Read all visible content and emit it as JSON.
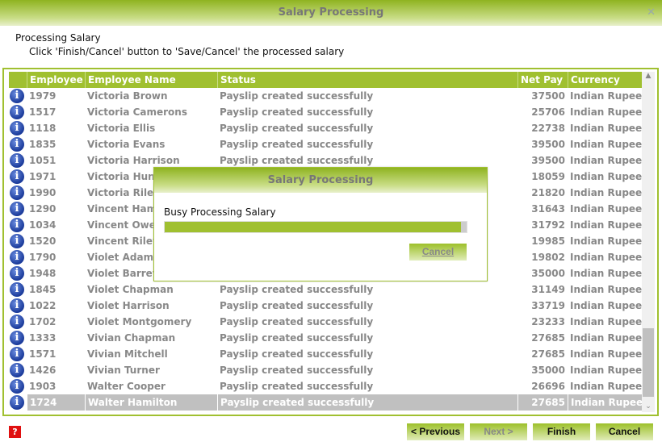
{
  "window": {
    "title": "Salary Processing",
    "close": "✕"
  },
  "heading": "Processing Salary",
  "instruction": "Click 'Finish/Cancel' button to 'Save/Cancel' the processed salary",
  "table": {
    "columns": [
      "Employee Id",
      "Employee Name",
      "Status",
      "Net Pay",
      "Currency"
    ],
    "rows": [
      [
        "1979",
        "Victoria Brown",
        "Payslip created successfully",
        "37500",
        "Indian Rupees"
      ],
      [
        "1517",
        "Victoria Camerons",
        "Payslip created successfully",
        "25706",
        "Indian Rupees"
      ],
      [
        "1118",
        "Victoria Ellis",
        "Payslip created successfully",
        "22738",
        "Indian Rupees"
      ],
      [
        "1835",
        "Victoria Evans",
        "Payslip created successfully",
        "39500",
        "Indian Rupees"
      ],
      [
        "1051",
        "Victoria Harrison",
        "Payslip created successfully",
        "39500",
        "Indian Rupees"
      ],
      [
        "1971",
        "Victoria Hunt",
        "",
        "18059",
        "Indian Rupees"
      ],
      [
        "1990",
        "Victoria Riley",
        "",
        "21820",
        "Indian Rupees"
      ],
      [
        "1290",
        "Vincent Hamil",
        "",
        "31643",
        "Indian Rupees"
      ],
      [
        "1034",
        "Vincent Owen",
        "",
        "31792",
        "Indian Rupees"
      ],
      [
        "1520",
        "Vincent Riley",
        "",
        "19985",
        "Indian Rupees"
      ],
      [
        "1790",
        "Violet Adams",
        "",
        "19802",
        "Indian Rupees"
      ],
      [
        "1948",
        "Violet Barrett",
        "",
        "35000",
        "Indian Rupees"
      ],
      [
        "1845",
        "Violet Chapman",
        "Payslip created successfully",
        "31149",
        "Indian Rupees"
      ],
      [
        "1022",
        "Violet Harrison",
        "Payslip created successfully",
        "33719",
        "Indian Rupees"
      ],
      [
        "1702",
        "Violet Montgomery",
        "Payslip created successfully",
        "23233",
        "Indian Rupees"
      ],
      [
        "1333",
        "Vivian Chapman",
        "Payslip created successfully",
        "27685",
        "Indian Rupees"
      ],
      [
        "1571",
        "Vivian Mitchell",
        "Payslip created successfully",
        "27685",
        "Indian Rupees"
      ],
      [
        "1426",
        "Vivian Turner",
        "Payslip created successfully",
        "35000",
        "Indian Rupees"
      ],
      [
        "1903",
        "Walter Cooper",
        "Payslip created successfully",
        "26696",
        "Indian Rupees"
      ],
      [
        "1724",
        "Walter Hamilton",
        "Payslip created successfully",
        "27685",
        "Indian Rupees"
      ]
    ],
    "selected_row": 19,
    "row_icon": "info-icon"
  },
  "dialog": {
    "title": "Salary Processing",
    "message": "Busy Processing Salary",
    "progress_percent": 98,
    "cancel": "Cancel"
  },
  "buttons": {
    "previous": "< Previous",
    "next": "Next >",
    "finish": "Finish",
    "cancel": "Cancel"
  },
  "help": "?",
  "colors": {
    "accent": "#a0c030",
    "selected": "#c0c0c0",
    "help": "#e01010"
  }
}
